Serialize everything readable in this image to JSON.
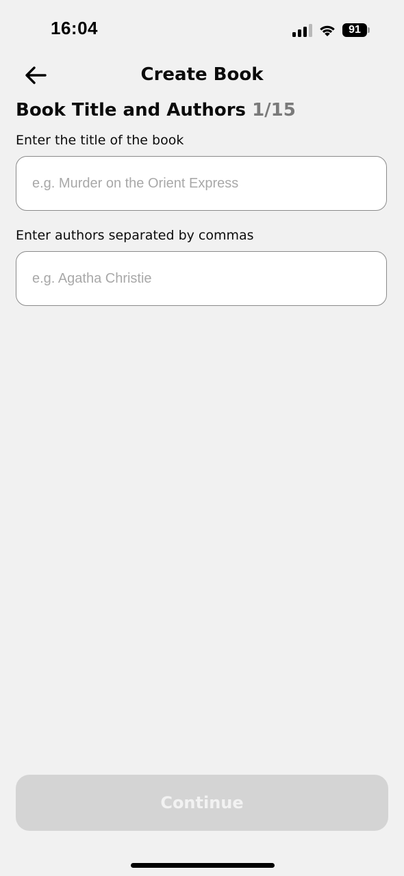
{
  "status_bar": {
    "time": "16:04",
    "battery_level": "91",
    "signal_bars_active": 3,
    "signal_bars_total": 4
  },
  "header": {
    "title": "Create Book",
    "back_icon": "arrow-left-icon"
  },
  "step": {
    "heading": "Book Title and Authors",
    "counter": "1/15"
  },
  "fields": {
    "title": {
      "label": "Enter the title of the book",
      "placeholder": "e.g. Murder on the Orient Express",
      "value": ""
    },
    "authors": {
      "label": "Enter authors separated by commas",
      "placeholder": "e.g. Agatha Christie",
      "value": ""
    }
  },
  "footer": {
    "continue_label": "Continue",
    "continue_enabled": false
  },
  "colors": {
    "background": "#f1f1f1",
    "text": "#0b0b0b",
    "counter": "#7a7a7a",
    "field_border": "#8a8a8a",
    "placeholder": "#a8a8a8",
    "button_disabled_bg": "#d4d4d4",
    "button_disabled_text": "#f2f2f2"
  }
}
